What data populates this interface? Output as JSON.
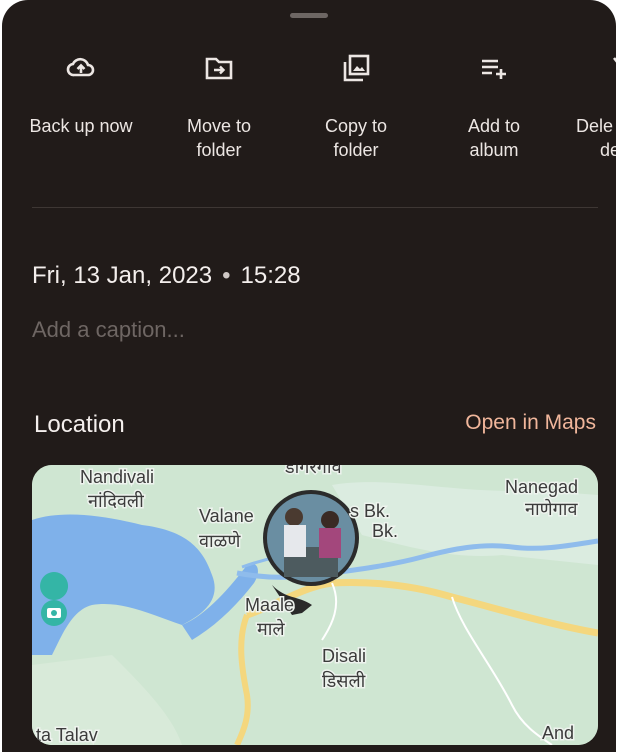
{
  "actions": [
    {
      "icon": "cloud-upload-icon",
      "label_line1": "Back up now",
      "label_line2": ""
    },
    {
      "icon": "move-folder-icon",
      "label_line1": "Move to",
      "label_line2": "folder"
    },
    {
      "icon": "copy-photo-icon",
      "label_line1": "Copy to",
      "label_line2": "folder"
    },
    {
      "icon": "add-to-album-icon",
      "label_line1": "Add to",
      "label_line2": "album"
    },
    {
      "icon": "delete-icon",
      "label_line1": "Dele",
      "label_line2": "de"
    }
  ],
  "details": {
    "date": "Fri, 13 Jan, 2023",
    "separator": "•",
    "time": "15:28",
    "caption_placeholder": "Add a caption..."
  },
  "location": {
    "title": "Location",
    "open_maps_label": "Open in Maps"
  },
  "map": {
    "labels": {
      "nandivali": "Nandivali",
      "nandivali_mr": "नांदिवली",
      "dongargaon_mr": "डोंगरगाव",
      "valane": "Valane",
      "valane_mr": "वाळणे",
      "s_bk": "s Bk.",
      "bk": "Bk.",
      "nanegad": "Nanegad",
      "nanegad_mr": "नाणेगाव",
      "maale": "Maale",
      "maale_mr": "माले",
      "disali": "Disali",
      "disali_mr": "डिसली",
      "talay": "ta Talav",
      "and": "And"
    },
    "colors": {
      "water": "#7fb1ea",
      "land": "#cfe6d2",
      "road": "#f4d77e",
      "pin": "#34b5a6"
    }
  }
}
